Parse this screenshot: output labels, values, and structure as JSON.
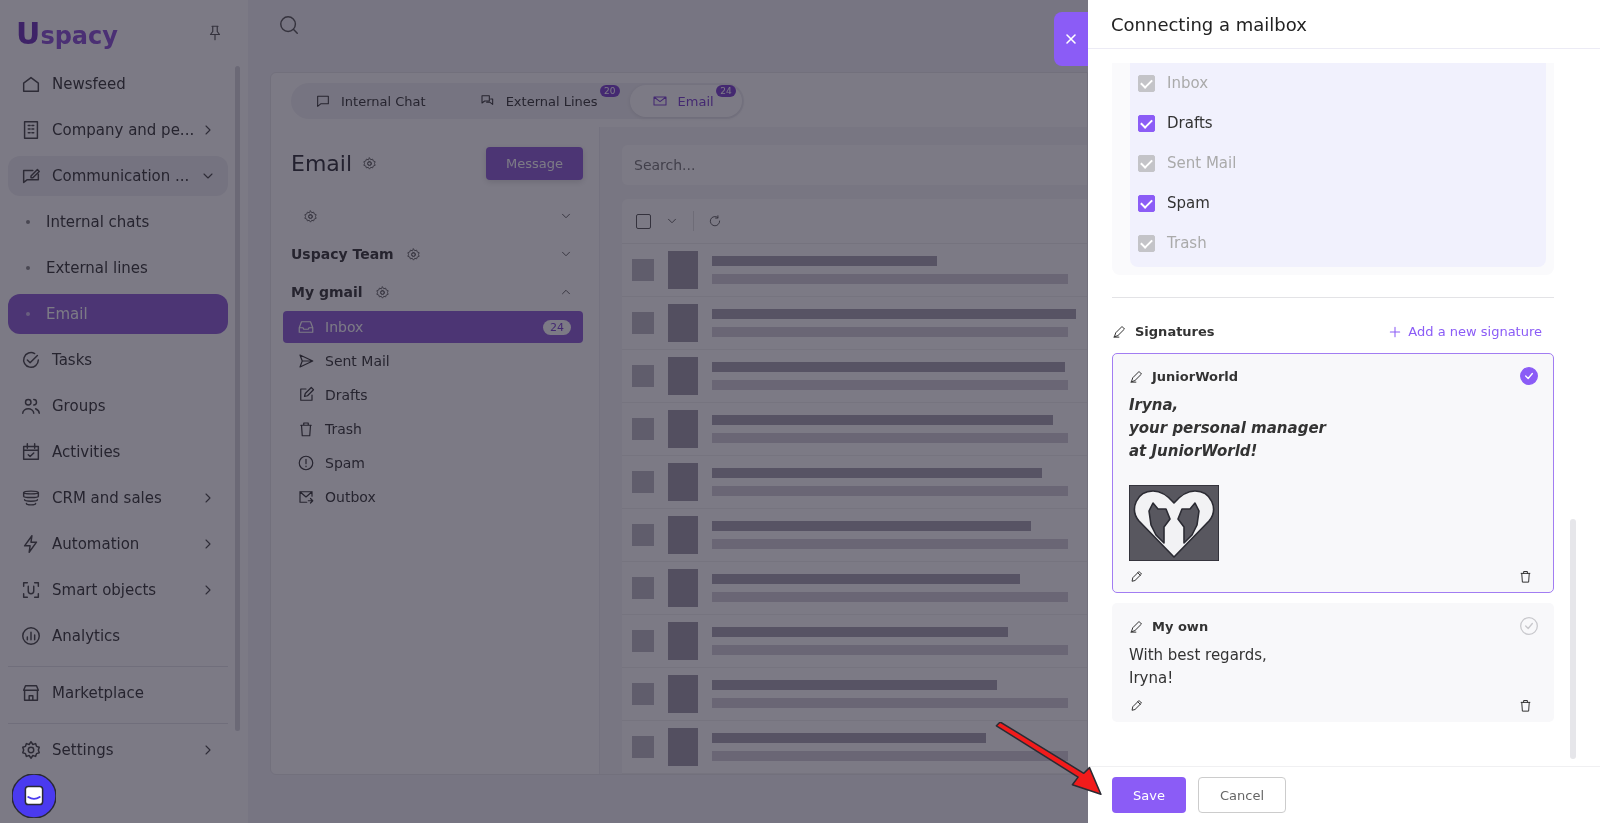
{
  "logo": {
    "mark": "U",
    "text": "spacy"
  },
  "sidebar": {
    "sections": [
      {
        "items": [
          {
            "label": "Newsfeed",
            "selected": false
          },
          {
            "label": "Company and pe...",
            "selected": false,
            "expanded": false
          },
          {
            "label": "Communication ...",
            "selected": false,
            "expanded": true,
            "children": [
              {
                "label": "Internal chats",
                "selected": false
              },
              {
                "label": "External lines",
                "selected": false
              },
              {
                "label": "Email",
                "selected": true
              }
            ]
          },
          {
            "label": "Tasks",
            "selected": false
          },
          {
            "label": "Groups",
            "selected": false
          },
          {
            "label": "Activities",
            "selected": false
          },
          {
            "label": "CRM and sales",
            "selected": false,
            "expanded": false
          },
          {
            "label": "Automation",
            "selected": false,
            "expanded": false
          },
          {
            "label": "Smart objects",
            "selected": false,
            "expanded": false
          },
          {
            "label": "Analytics",
            "selected": false
          }
        ]
      },
      {
        "items": [
          {
            "label": "Marketplace",
            "selected": false
          }
        ]
      },
      {
        "items": [
          {
            "label": "Settings",
            "selected": false,
            "expanded": false
          }
        ]
      }
    ]
  },
  "tabs": [
    {
      "label": "Internal Chat",
      "selected": false
    },
    {
      "label": "External Lines",
      "badge": "20",
      "selected": false
    },
    {
      "label": "Email",
      "badge": "24",
      "selected": true
    }
  ],
  "email": {
    "title": "Email",
    "new_button": "Message",
    "search": {
      "placeholder": "Search..."
    },
    "select_all": {
      "checked": false
    },
    "accounts": [
      {
        "expanded": false
      },
      {
        "name": "Uspacy Team",
        "expanded": false
      },
      {
        "name": "My gmail",
        "expanded": true,
        "folders": [
          {
            "label": "Inbox",
            "count": "24",
            "selected": true
          },
          {
            "label": "Sent Mail",
            "selected": false
          },
          {
            "label": "Drafts",
            "selected": false
          },
          {
            "label": "Trash",
            "selected": false
          },
          {
            "label": "Spam",
            "selected": false
          },
          {
            "label": "Outbox",
            "selected": false
          }
        ]
      }
    ]
  },
  "dialog": {
    "title": "Connecting a mailbox",
    "sync_folders": [
      {
        "label": "Inbox",
        "checked": true,
        "disabled": true
      },
      {
        "label": "Drafts",
        "checked": true,
        "disabled": false
      },
      {
        "label": "Sent Mail",
        "checked": true,
        "disabled": true
      },
      {
        "label": "Spam",
        "checked": true,
        "disabled": false
      },
      {
        "label": "Trash",
        "checked": true,
        "disabled": true
      }
    ],
    "signatures_label": "Signatures",
    "add_signature": "Add a new signature",
    "signatures": [
      {
        "name": "JuniorWorld",
        "selected": true,
        "emphasized": true,
        "image": true,
        "lines": [
          "Iryna,",
          "your personal manager",
          "at JuniorWorld!"
        ]
      },
      {
        "name": "My own",
        "selected": false,
        "emphasized": false,
        "image": false,
        "lines": [
          "With best regards,",
          "Iryna!"
        ]
      }
    ],
    "buttons": {
      "save": "Save",
      "cancel": "Cancel"
    }
  }
}
